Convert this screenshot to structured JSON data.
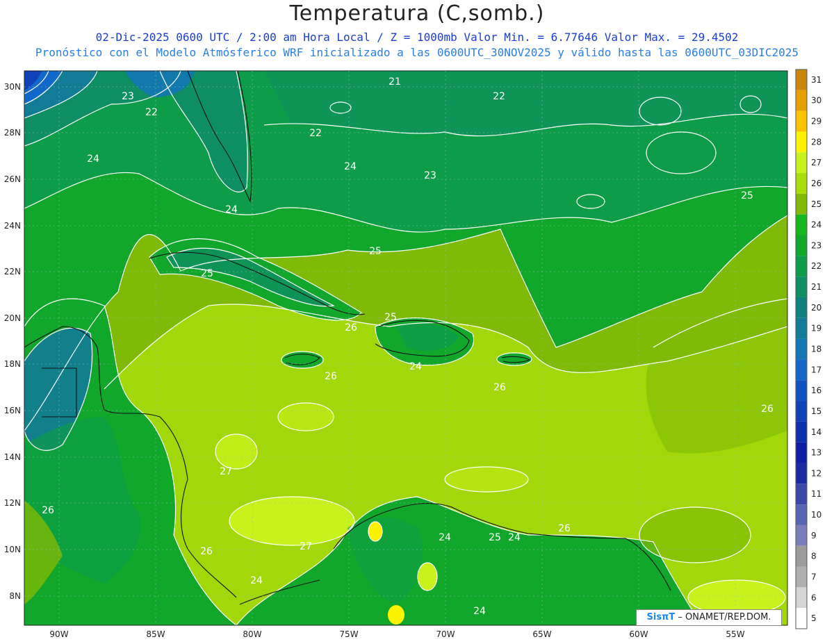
{
  "title": "Temperatura (C,somb.)",
  "subtitle_line1": "02-Dic-2025  0600 UTC / 2:00 am Hora Local / Z = 1000mb   Valor Min. = 6.77646  Valor Max. = 29.4502",
  "subtitle_line2": "Pronóstico con el Modelo Atmósferico WRF inicializado a las 0600UTC_30NOV2025 y válido hasta las  0600UTC_03DIC2025",
  "credit": {
    "logo": "SisπT",
    "text": "– ONAMET/REP.DOM."
  },
  "axes": {
    "lat_labels": [
      "30N",
      "28N",
      "26N",
      "24N",
      "22N",
      "20N",
      "18N",
      "16N",
      "14N",
      "12N",
      "10N",
      "8N"
    ],
    "lon_labels": [
      "90W",
      "85W",
      "80W",
      "75W",
      "70W",
      "65W",
      "60W",
      "55W"
    ]
  },
  "colorbar": {
    "labels": [
      "31",
      "30",
      "29",
      "28",
      "27",
      "26",
      "25",
      "24",
      "23",
      "22",
      "21",
      "20",
      "19",
      "18",
      "17",
      "16",
      "15",
      "14",
      "13",
      "12",
      "11",
      "10",
      "9",
      "8",
      "7",
      "6",
      "5"
    ],
    "colors": [
      "#c8860a",
      "#e49f00",
      "#ffc200",
      "#fdf200",
      "#c8f21c",
      "#a8dc0a",
      "#7fba06",
      "#14b81e",
      "#10a72b",
      "#0d9c47",
      "#0e8e63",
      "#10807f",
      "#127c96",
      "#1277b4",
      "#1268c8",
      "#1152c2",
      "#1041b8",
      "#0e2fae",
      "#0c1ea4",
      "#1b2aa2",
      "#3a48aa",
      "#5766b2",
      "#7a7fbc",
      "#9b9b9b",
      "#aeaeae",
      "#d4d4d4",
      "#ffffff"
    ]
  },
  "contour_labels": [
    {
      "text": "21"
    },
    {
      "text": "22"
    },
    {
      "text": "23"
    },
    {
      "text": "22"
    },
    {
      "text": "22"
    },
    {
      "text": "24"
    },
    {
      "text": "24"
    },
    {
      "text": "23"
    },
    {
      "text": "24"
    },
    {
      "text": "25"
    },
    {
      "text": "25"
    },
    {
      "text": "25"
    },
    {
      "text": "26"
    },
    {
      "text": "25"
    },
    {
      "text": "24"
    },
    {
      "text": "26"
    },
    {
      "text": "26"
    },
    {
      "text": "26"
    },
    {
      "text": "27"
    },
    {
      "text": "26"
    },
    {
      "text": "26"
    },
    {
      "text": "27"
    },
    {
      "text": "24"
    },
    {
      "text": "25"
    },
    {
      "text": "24"
    },
    {
      "text": "26"
    },
    {
      "text": "24"
    },
    {
      "text": "24"
    }
  ],
  "colors": {
    "title": "#222222",
    "subtitle1": "#1a3fd0",
    "subtitle2": "#2a7ee8"
  }
}
